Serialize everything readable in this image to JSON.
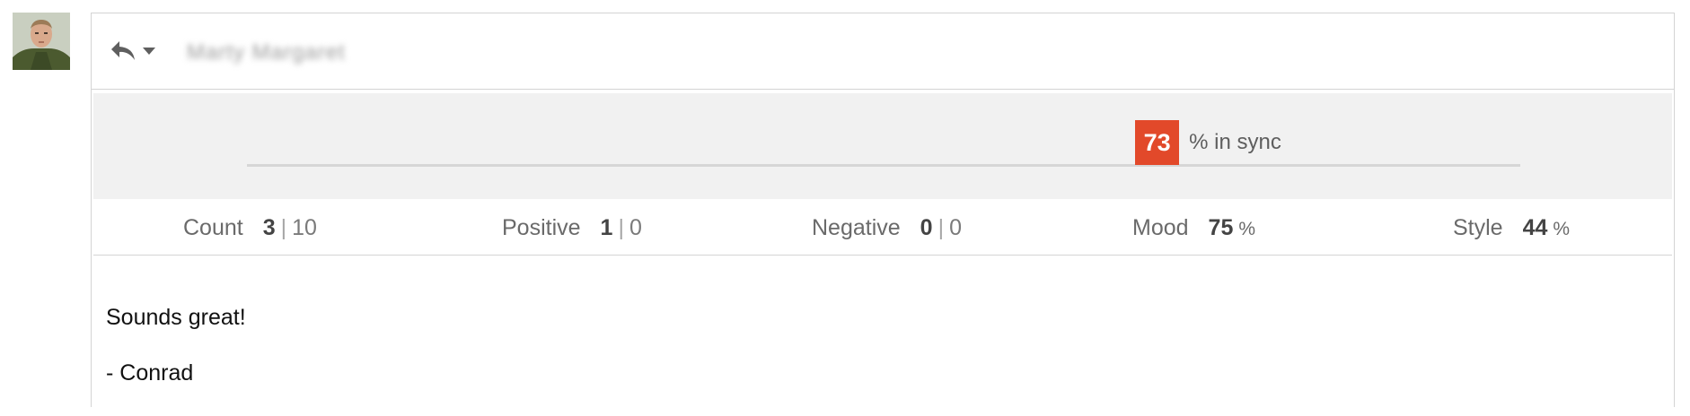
{
  "avatar": {
    "icon": "user-photo-icon"
  },
  "header": {
    "reply_icon": "reply-icon",
    "dropdown_icon": "caret-down-icon",
    "sender_name": "Marty Margaret"
  },
  "sync": {
    "percent": "73",
    "percent_value": 0.73,
    "label": "% in sync",
    "badge_color": "#e2492a"
  },
  "stats": {
    "count": {
      "label": "Count",
      "value": "3",
      "sep": "|",
      "secondary": "10"
    },
    "positive": {
      "label": "Positive",
      "value": "1",
      "sep": "|",
      "secondary": "0"
    },
    "negative": {
      "label": "Negative",
      "value": "0",
      "sep": "|",
      "secondary": "0"
    },
    "mood": {
      "label": "Mood",
      "value": "75",
      "unit": "%"
    },
    "style": {
      "label": "Style",
      "value": "44",
      "unit": "%"
    }
  },
  "message": {
    "line1": "Sounds great!",
    "line2": "- Conrad"
  }
}
